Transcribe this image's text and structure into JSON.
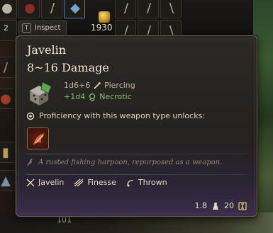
{
  "inventory": {
    "gold_amount": "1930",
    "slot_counter": "2",
    "bottom_counter": "101"
  },
  "inspect_tab": {
    "key": "T",
    "label": "Inspect"
  },
  "item": {
    "name": "Javelin",
    "damage": "8~16 Damage",
    "primary_dice": "1d6+6",
    "primary_type": "Piercing",
    "bonus_dice": "+1d4",
    "bonus_type": "Necrotic",
    "proficiency_text": "Proficiency with this weapon type unlocks:",
    "flavor_text": "A rusted fishing harpoon, repurposed as a weapon.",
    "properties": [
      {
        "label": "Javelin",
        "icon": "javelin-icon"
      },
      {
        "label": "Finesse",
        "icon": "finesse-icon"
      },
      {
        "label": "Thrown",
        "icon": "thrown-icon"
      }
    ],
    "weight": "1.8",
    "value": "20"
  },
  "colors": {
    "necrotic_green": "#7fc47a",
    "border_bronze": "#6f6656"
  }
}
